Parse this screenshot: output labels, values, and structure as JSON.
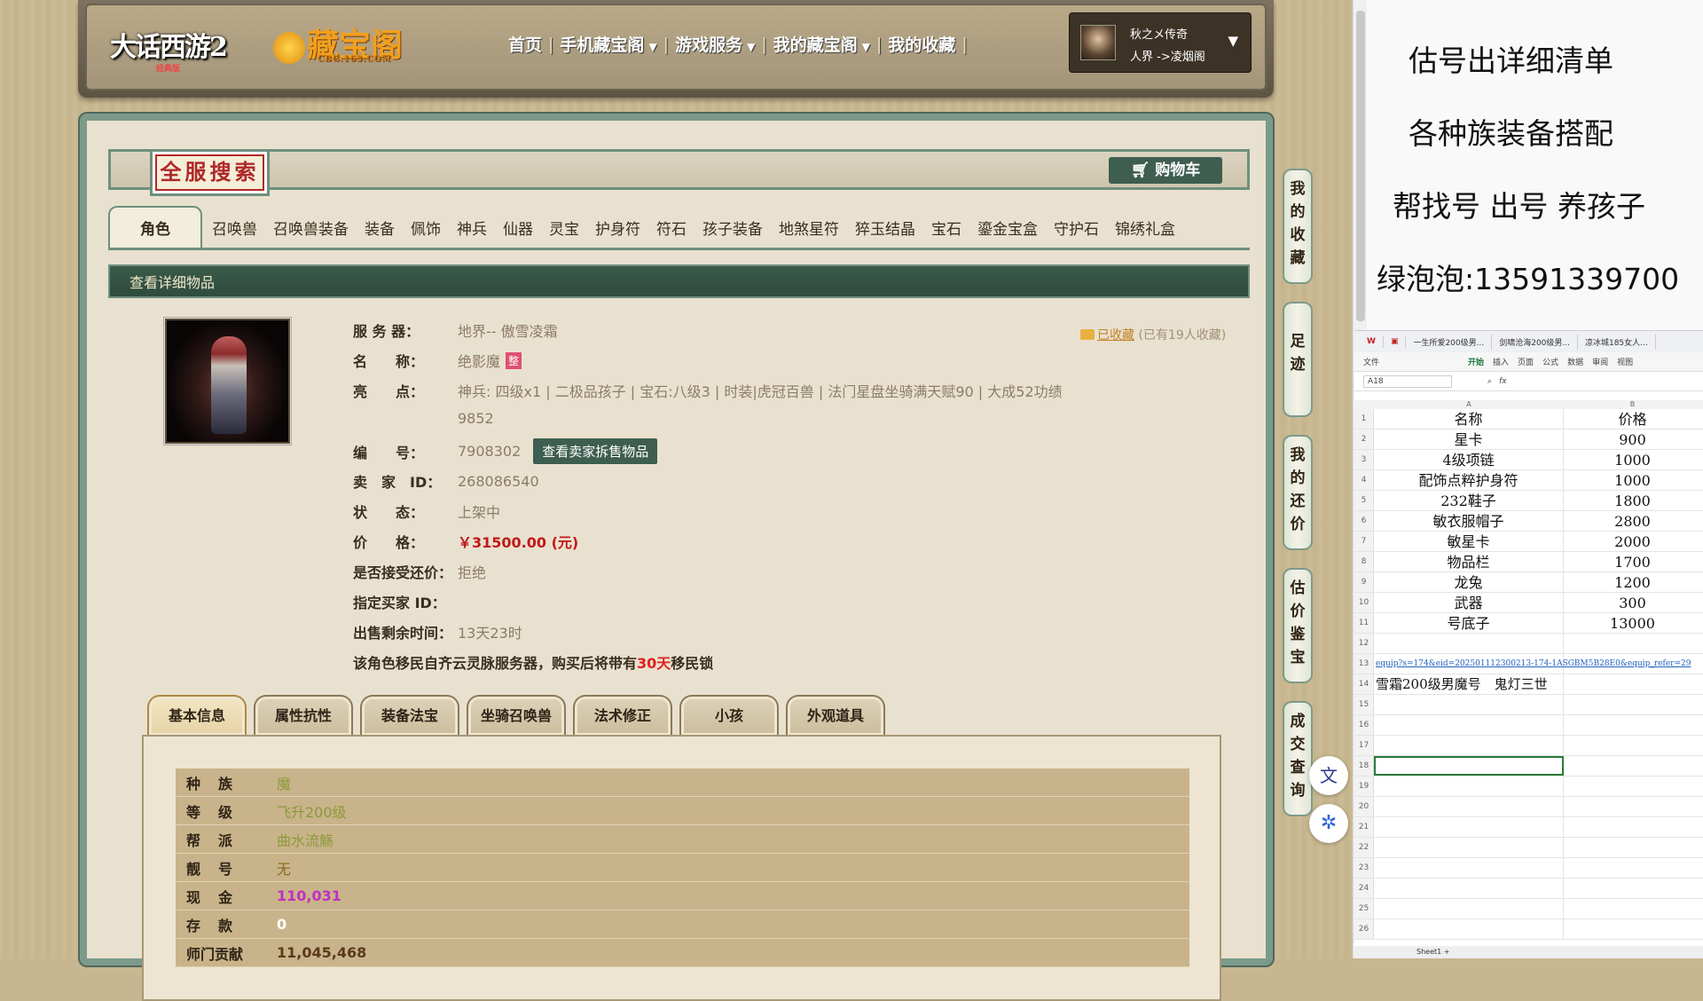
{
  "header": {
    "logo_game": "大话西游2",
    "logo_game_sub": "经典版",
    "logo_site": "藏宝阁",
    "logo_site_sub": "CBG.163.COM",
    "nav": [
      "首页",
      "手机藏宝阁",
      "游戏服务",
      "我的藏宝阁",
      "我的收藏"
    ],
    "user_name": "秋之メ传奇",
    "user_server": "人界 ->凌烟阁"
  },
  "panel": {
    "search_label": "全服搜索",
    "cart_label": "购物车",
    "tabs": [
      "角色",
      "召唤兽",
      "召唤兽装备",
      "装备",
      "佩饰",
      "神兵",
      "仙器",
      "灵宝",
      "护身符",
      "符石",
      "孩子装备",
      "地煞星符",
      "猝玉结晶",
      "宝石",
      "鎏金宝盒",
      "守护石",
      "锦绣礼盒"
    ],
    "subbar": "查看详细物品"
  },
  "item": {
    "favorite_link": "已收藏",
    "favorite_count": "(已有19人收藏)",
    "server_label": "服 务 器：",
    "server_value": "地界-- 傲雪凌霜",
    "name_label": "名　　称：",
    "name_value": "绝影魔",
    "name_badge": "整",
    "highlight_label": "亮　　点：",
    "highlight_value": "神兵: 四级x1 | 二极品孩子 | 宝石:八级3 | 时装|虎冠百兽 | 法门星盘坐骑满天赋90 | 大成52功绩",
    "highlight_value2": "9852",
    "id_label": "编　　号：",
    "id_value": "7908302",
    "seller_items_btn": "查看卖家拆售物品",
    "seller_label": "卖　家　ID：",
    "seller_value": "268086540",
    "status_label": "状　　态：",
    "status_value": "上架中",
    "price_label": "价　　格：",
    "price_value": "￥31500.00 (元)",
    "counter_label": "是否接受还价：",
    "counter_value": "拒绝",
    "buyer_label": "指定买家 ID：",
    "buyer_value": "",
    "remain_label": "出售剩余时间：",
    "remain_value": "13天23时",
    "warn_pre": "该角色移民自齐云灵脉服务器，购买后将带有",
    "warn_days": "30天",
    "warn_post": "移民锁"
  },
  "subtabs": [
    "基本信息",
    "属性抗性",
    "装备法宝",
    "坐骑召唤兽",
    "法术修正",
    "小孩",
    "外观道具"
  ],
  "basic_info": [
    {
      "label": "种族",
      "value": "魔",
      "color": "#8a9a3a"
    },
    {
      "label": "等级",
      "value": "飞升200级",
      "color": "#8a9a3a"
    },
    {
      "label": "帮派",
      "value": "曲水流觞",
      "color": "#8a9a3a"
    },
    {
      "label": "靓号",
      "value": "无",
      "color": "#8a6a20"
    },
    {
      "label": "现金",
      "value": "110,031",
      "color": "#c030c0"
    },
    {
      "label": "存款",
      "value": "0",
      "color": "#ffffff"
    },
    {
      "label": "师门贡献",
      "value": "11,045,468",
      "color": "#5a3a1a"
    }
  ],
  "side_buttons": [
    "我的收藏",
    "足迹",
    "我的还价",
    "估价鉴宝",
    "成交查询"
  ],
  "notes": [
    "估号出详细清单",
    "各种族装备搭配",
    "帮找号 出号 养孩子",
    "绿泡泡:13591339700"
  ],
  "spreadsheet": {
    "tabs": [
      "一生所爱200级男...",
      "剑啸沧海200级男...",
      "凉冰城185女人..."
    ],
    "menu": [
      "文件",
      "开始",
      "插入",
      "页面",
      "公式",
      "数据",
      "审阅",
      "视图"
    ],
    "cell_name": "A18",
    "fx": "fx",
    "col_headers": [
      "A",
      "B"
    ],
    "rows": [
      {
        "n": "1",
        "a": "名称",
        "b": "价格"
      },
      {
        "n": "2",
        "a": "星卡",
        "b": "900"
      },
      {
        "n": "3",
        "a": "4级项链",
        "b": "1000"
      },
      {
        "n": "4",
        "a": "配饰点粹护身符",
        "b": "1000"
      },
      {
        "n": "5",
        "a": "232鞋子",
        "b": "1800"
      },
      {
        "n": "6",
        "a": "敏衣服帽子",
        "b": "2800"
      },
      {
        "n": "7",
        "a": "敏星卡",
        "b": "2000"
      },
      {
        "n": "8",
        "a": "物品栏",
        "b": "1700"
      },
      {
        "n": "9",
        "a": "龙兔",
        "b": "1200"
      },
      {
        "n": "10",
        "a": "武器",
        "b": "300"
      },
      {
        "n": "11",
        "a": "号底子",
        "b": "13000"
      },
      {
        "n": "12",
        "a": "",
        "b": ""
      },
      {
        "n": "13",
        "a": "equip?s=174&eid=202501112300213-174-1ASGBM5B28E0&equip_refer=29",
        "b": ""
      },
      {
        "n": "14",
        "a": "雪霜200级男魔号　鬼灯三世",
        "b": ""
      },
      {
        "n": "15",
        "a": "",
        "b": ""
      },
      {
        "n": "16",
        "a": "",
        "b": ""
      },
      {
        "n": "17",
        "a": "",
        "b": ""
      },
      {
        "n": "18",
        "a": "",
        "b": ""
      },
      {
        "n": "19",
        "a": "",
        "b": ""
      },
      {
        "n": "20",
        "a": "",
        "b": ""
      },
      {
        "n": "21",
        "a": "",
        "b": ""
      },
      {
        "n": "22",
        "a": "",
        "b": ""
      },
      {
        "n": "23",
        "a": "",
        "b": ""
      },
      {
        "n": "24",
        "a": "",
        "b": ""
      },
      {
        "n": "25",
        "a": "",
        "b": ""
      },
      {
        "n": "26",
        "a": "",
        "b": ""
      }
    ],
    "sheet_tab": "Sheet1"
  }
}
